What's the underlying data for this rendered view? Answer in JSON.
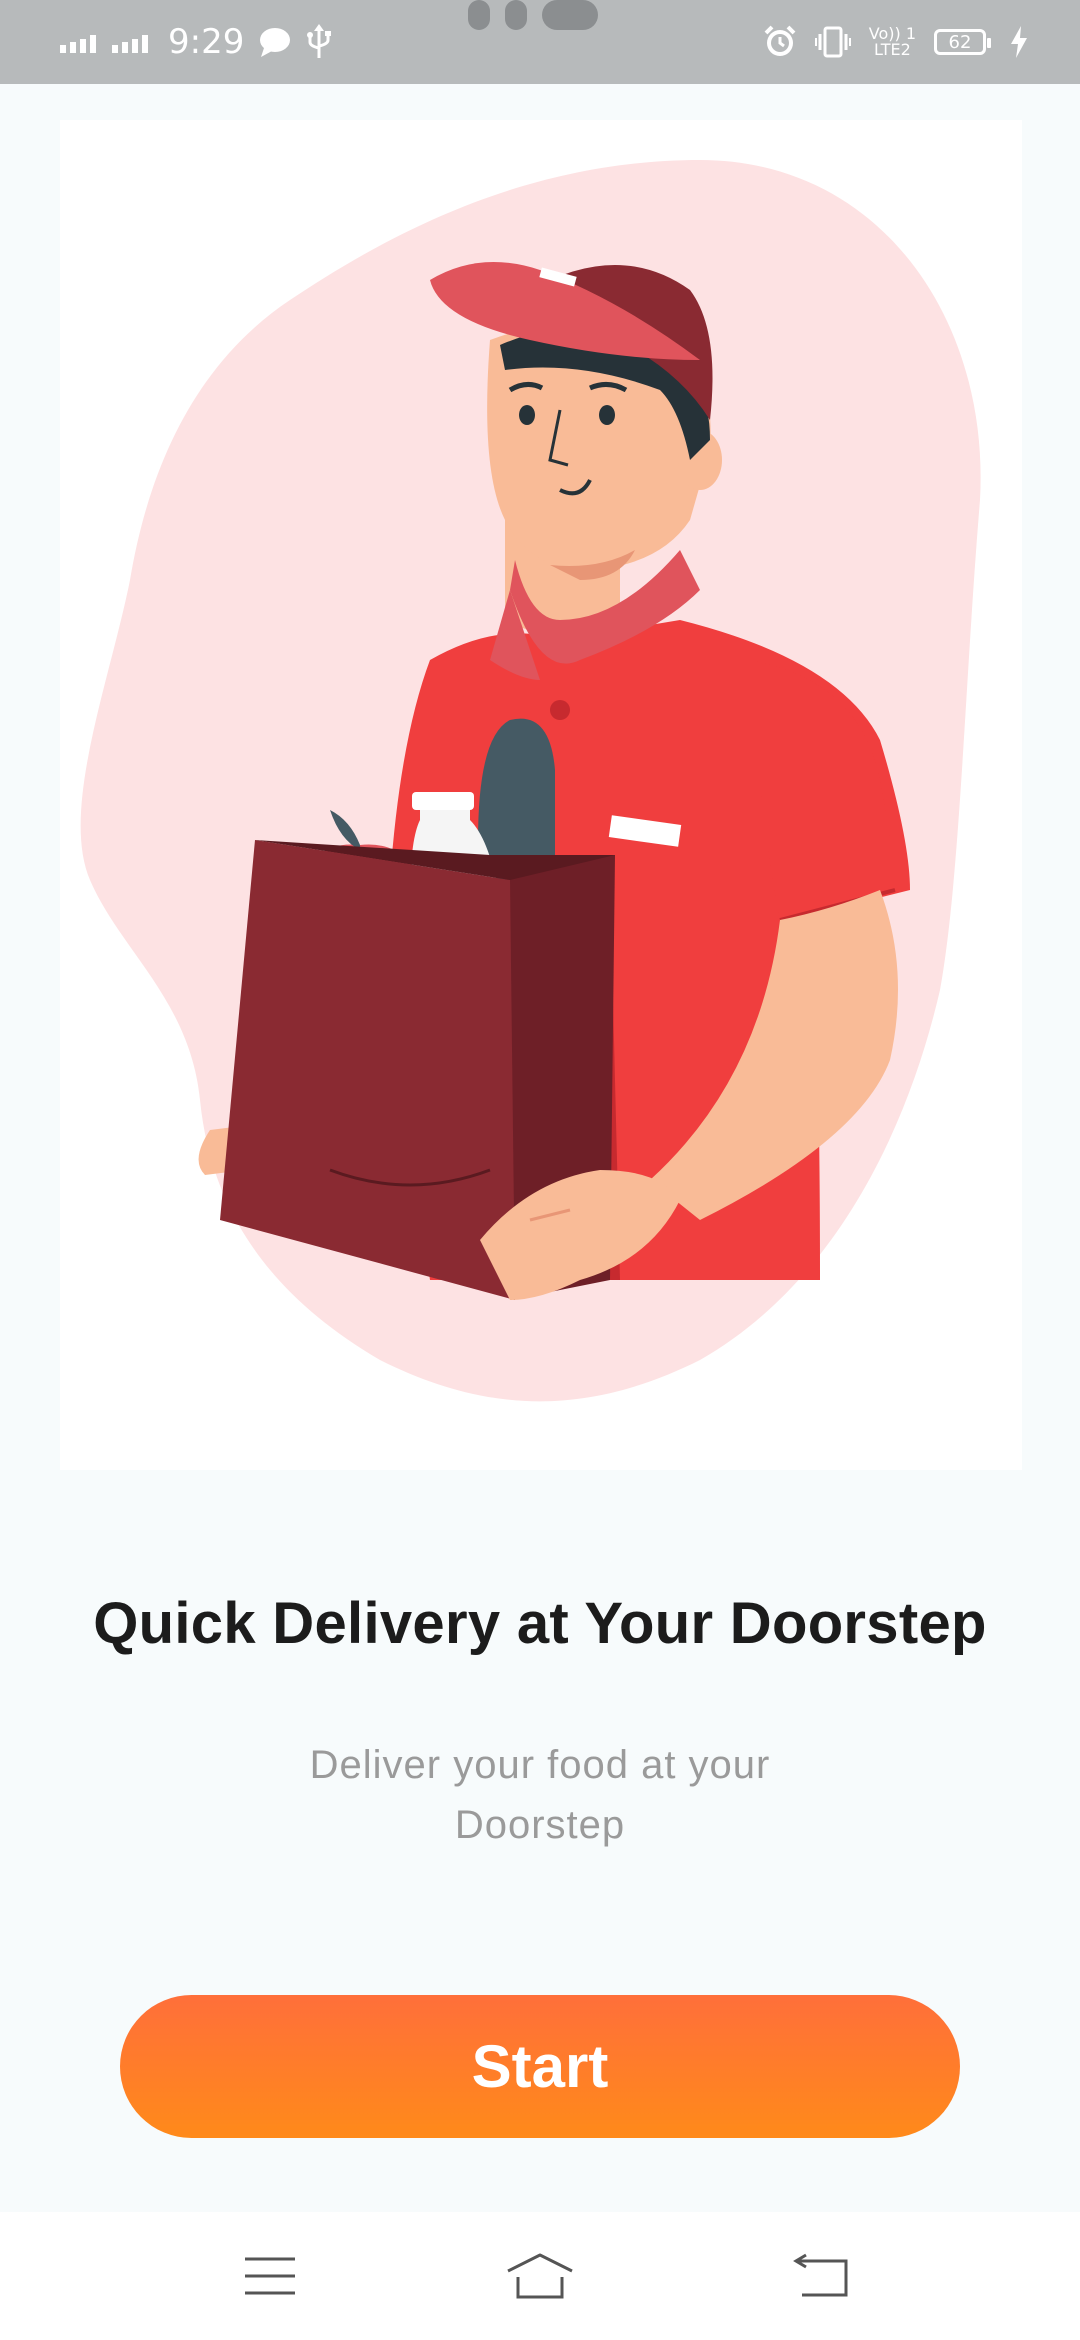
{
  "status_bar": {
    "time": "9:29",
    "battery_level": "62",
    "network_label_top": "Vo)) 1",
    "network_label_bottom": "LTE2",
    "icons": [
      "signal-1-icon",
      "signal-2-icon",
      "chat-bubble-icon",
      "usb-icon",
      "alarm-icon",
      "vibrate-icon",
      "volte-icon",
      "battery-icon",
      "charging-icon"
    ]
  },
  "onboarding": {
    "illustration": "delivery-man-with-grocery-bag",
    "title": "Quick Delivery at Your Doorstep",
    "subtitle": "Deliver your food at your Doorstep",
    "start_label": "Start"
  },
  "colors": {
    "accent_top": "#ff6f3a",
    "accent_bottom": "#ff8a1a",
    "shirt_red": "#f03e3e",
    "bag_maroon": "#8a2a32"
  },
  "nav_bar": {
    "icons": [
      "menu-icon",
      "home-icon",
      "back-icon"
    ]
  }
}
